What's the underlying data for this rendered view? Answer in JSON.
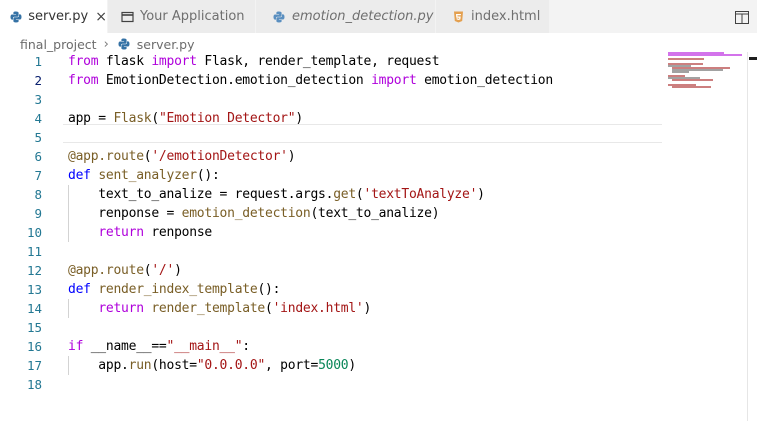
{
  "tabs": [
    {
      "label": "server.py",
      "active": true,
      "icon": "python-icon",
      "close": "×"
    },
    {
      "label": "Your Application",
      "active": false,
      "icon": "window-icon"
    },
    {
      "label": "emotion_detection.py",
      "active": false,
      "icon": "python-icon"
    },
    {
      "label": "index.html",
      "active": false,
      "icon": "html-icon"
    }
  ],
  "breadcrumb": {
    "folder": "final_project",
    "separator": "›",
    "file": "server.py"
  },
  "editor": {
    "language": "python",
    "current_line": 2,
    "lines": [
      {
        "n": "1",
        "text": "from flask import Flask, render_template, request"
      },
      {
        "n": "2",
        "text": "from EmotionDetection.emotion_detection import emotion_detection"
      },
      {
        "n": "3",
        "text": ""
      },
      {
        "n": "4",
        "text": "app = Flask(\"Emotion Detector\")"
      },
      {
        "n": "5",
        "text": ""
      },
      {
        "n": "6",
        "text": "@app.route('/emotionDetector')"
      },
      {
        "n": "7",
        "text": "def sent_analyzer():"
      },
      {
        "n": "8",
        "text": "    text_to_analize = request.args.get('textToAnalyze')"
      },
      {
        "n": "9",
        "text": "    renponse = emotion_detection(text_to_analize)"
      },
      {
        "n": "10",
        "text": "    return renponse"
      },
      {
        "n": "11",
        "text": ""
      },
      {
        "n": "12",
        "text": "@app.route('/')"
      },
      {
        "n": "13",
        "text": "def render_index_template():"
      },
      {
        "n": "14",
        "text": "    return render_template('index.html')"
      },
      {
        "n": "15",
        "text": ""
      },
      {
        "n": "16",
        "text": "if __name__==\"__main__\":"
      },
      {
        "n": "17",
        "text": "    app.run(host=\"0.0.0.0\", port=5000)"
      },
      {
        "n": "18",
        "text": ""
      }
    ]
  },
  "colors": {
    "keyword_control": "#af00db",
    "keyword": "#0000ff",
    "function": "#795e26",
    "string": "#a31515",
    "number": "#098658",
    "line_number": "#237893",
    "active_line_number": "#0b216f"
  }
}
